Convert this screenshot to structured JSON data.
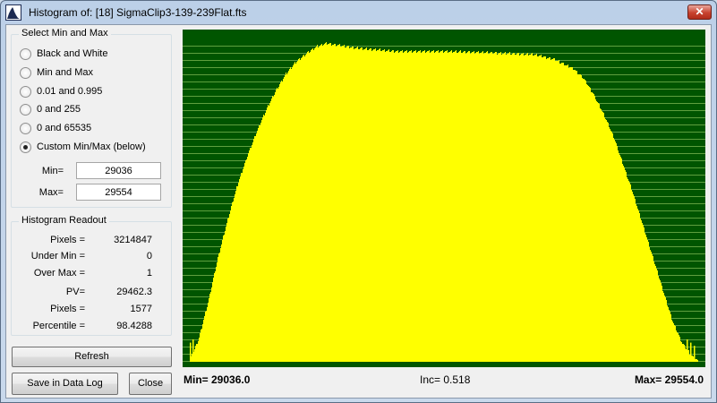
{
  "window": {
    "title": "Histogram of:  [18] SigmaClip3-139-239Flat.fts",
    "close_glyph": "✕"
  },
  "select": {
    "legend": "Select Min and Max",
    "options": [
      {
        "label": "Black and White",
        "checked": false
      },
      {
        "label": "Min and Max",
        "checked": false
      },
      {
        "label": "0.01 and 0.995",
        "checked": false
      },
      {
        "label": "0 and 255",
        "checked": false
      },
      {
        "label": "0 and 65535",
        "checked": false
      },
      {
        "label": "Custom Min/Max (below)",
        "checked": true
      }
    ],
    "min_label": "Min=",
    "min_value": "29036",
    "max_label": "Max=",
    "max_value": "29554"
  },
  "readout": {
    "legend": "Histogram Readout",
    "rows": [
      {
        "label": "Pixels =",
        "value": "3214847"
      },
      {
        "label": "Under Min =",
        "value": "0"
      },
      {
        "label": "Over Max =",
        "value": "1"
      },
      {
        "label": "PV=",
        "value": "29462.3"
      },
      {
        "label": "Pixels =",
        "value": "1577"
      },
      {
        "label": "Percentile =",
        "value": "98.4288"
      }
    ]
  },
  "buttons": {
    "refresh": "Refresh",
    "save": "Save in Data Log",
    "close": "Close"
  },
  "axis": {
    "min_text": "Min= 29036.0",
    "inc_text": "Inc= 0.518",
    "max_text": "Max= 29554.0"
  },
  "colors": {
    "plot_bg": "#005500",
    "histogram": "#ffff00",
    "gridline": "#5f9f3f"
  },
  "chart_data": {
    "type": "area",
    "xlim": [
      29036.0,
      29554.0
    ],
    "x_increment": 0.518,
    "envelope_x": [
      29036,
      29046,
      29056,
      29066,
      29076,
      29086,
      29096,
      29106,
      29116,
      29126,
      29136,
      29146,
      29156,
      29166,
      29176,
      29186,
      29206,
      29246,
      29296,
      29346,
      29386,
      29406,
      29426,
      29436,
      29446,
      29456,
      29466,
      29476,
      29486,
      29496,
      29506,
      29516,
      29526,
      29536,
      29546,
      29554
    ],
    "envelope_relative_count": [
      0.0,
      0.07,
      0.19,
      0.33,
      0.45,
      0.56,
      0.65,
      0.73,
      0.8,
      0.86,
      0.91,
      0.945,
      0.97,
      0.99,
      1.0,
      0.995,
      0.985,
      0.975,
      0.975,
      0.97,
      0.965,
      0.95,
      0.92,
      0.89,
      0.84,
      0.78,
      0.71,
      0.62,
      0.53,
      0.43,
      0.33,
      0.23,
      0.13,
      0.06,
      0.02,
      0.0
    ]
  }
}
